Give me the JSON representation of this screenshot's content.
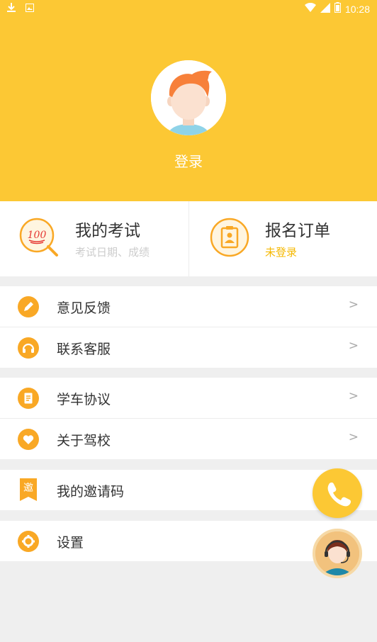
{
  "status_bar": {
    "time": "10:28",
    "left_icons": [
      "download-icon",
      "photo-icon"
    ],
    "right_icons": [
      "wifi-icon",
      "signal-icon",
      "battery-icon"
    ]
  },
  "profile": {
    "login_label": "登录",
    "avatar_icon": "user-avatar-icon"
  },
  "cards": {
    "exam": {
      "title": "我的考试",
      "subtitle": "考试日期、成绩",
      "icon": "score-100-search-icon"
    },
    "order": {
      "title": "报名订单",
      "subtitle": "未登录",
      "icon": "id-badge-icon"
    }
  },
  "menu": {
    "group1": [
      {
        "label": "意见反馈",
        "icon": "pencil-icon",
        "chevron": ">"
      },
      {
        "label": "联系客服",
        "icon": "headset-icon",
        "chevron": ">"
      }
    ],
    "group2": [
      {
        "label": "学车协议",
        "icon": "document-icon",
        "chevron": ">"
      },
      {
        "label": "关于驾校",
        "icon": "heart-icon",
        "chevron": ">"
      }
    ],
    "group3": [
      {
        "label": "我的邀请码",
        "icon": "invite-bookmark-icon",
        "icon_text": "邀"
      }
    ],
    "group4": [
      {
        "label": "设置",
        "icon": "gear-icon"
      }
    ]
  },
  "floating": {
    "call_icon": "phone-icon",
    "service_icon": "customer-service-agent-icon"
  },
  "colors": {
    "brand_yellow": "#fcc834",
    "icon_orange": "#f9a825",
    "order_subtitle": "#f5b800",
    "text_dark": "#333333",
    "text_muted": "#cccccc",
    "background": "#efefef"
  }
}
